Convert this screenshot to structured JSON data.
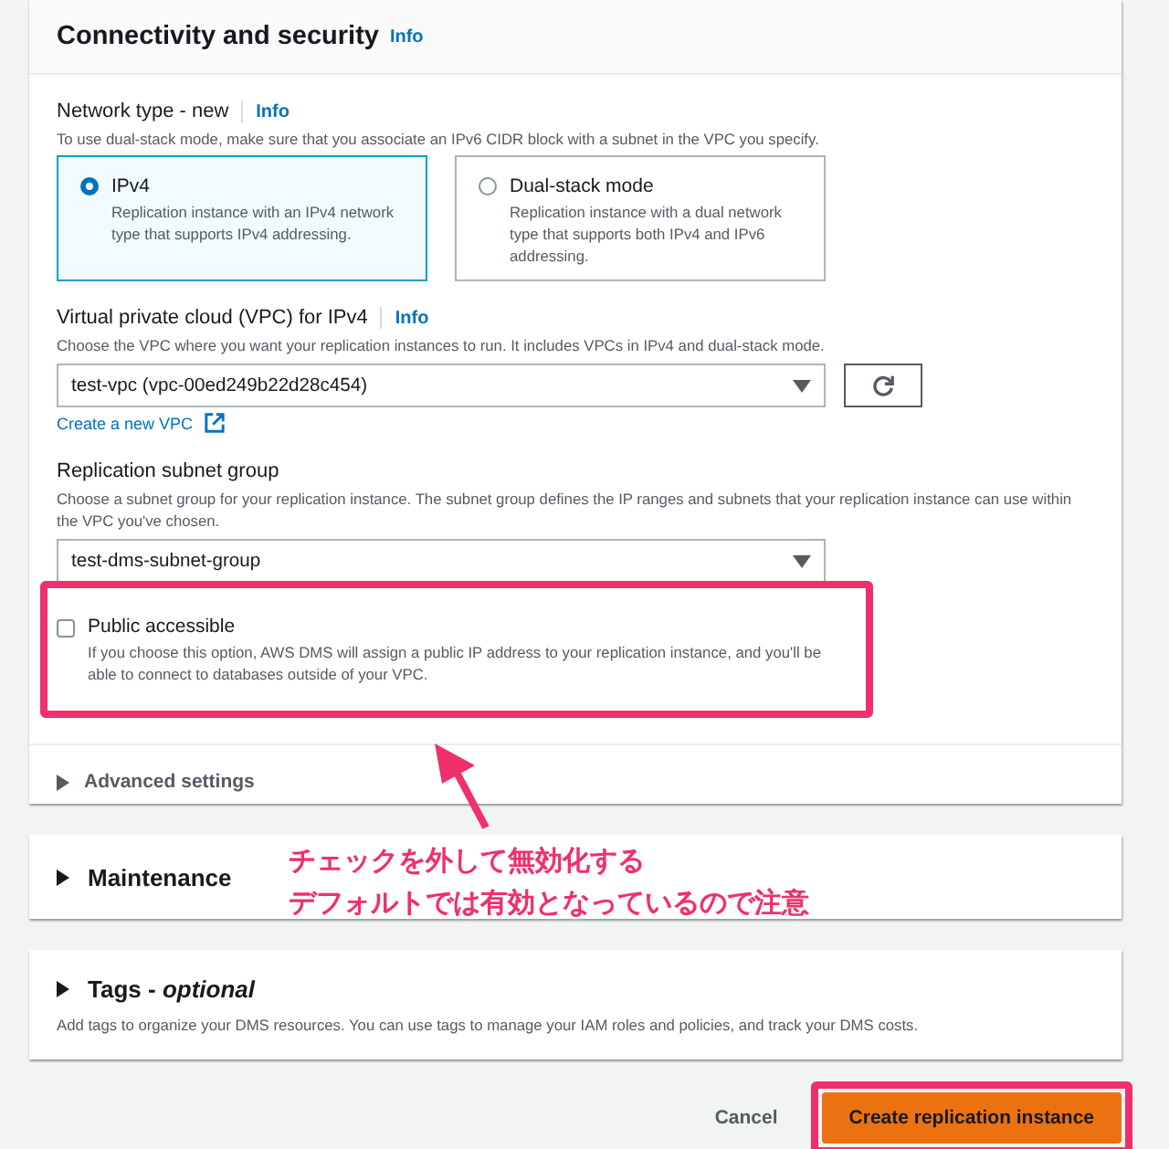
{
  "section": {
    "title": "Connectivity and security",
    "info": "Info"
  },
  "network_type": {
    "label": "Network type - new",
    "info": "Info",
    "description": "To use dual-stack mode, make sure that you associate an IPv6 CIDR block with a subnet in the VPC you specify.",
    "options": [
      {
        "label": "IPv4",
        "description": "Replication instance with an IPv4 network type that supports IPv4 addressing.",
        "selected": true
      },
      {
        "label": "Dual-stack mode",
        "description": "Replication instance with a dual network type that supports both IPv4 and IPv6 addressing.",
        "selected": false
      }
    ]
  },
  "vpc": {
    "label": "Virtual private cloud (VPC) for IPv4",
    "info": "Info",
    "description": "Choose the VPC where you want your replication instances to run. It includes VPCs in IPv4 and dual-stack mode.",
    "value": "test-vpc (vpc-00ed249b22d28c454)",
    "create_link": "Create a new VPC"
  },
  "subnet_group": {
    "label": "Replication subnet group",
    "description": "Choose a subnet group for your replication instance. The subnet group defines the IP ranges and subnets that your replication instance can use within the VPC you've chosen.",
    "value": "test-dms-subnet-group"
  },
  "public_accessible": {
    "label": "Public accessible",
    "description": "If you choose this option, AWS DMS will assign a public IP address to your replication instance, and you'll be able to connect to databases outside of your VPC.",
    "checked": false
  },
  "advanced_settings": {
    "label": "Advanced settings",
    "expanded": false
  },
  "maintenance": {
    "label": "Maintenance",
    "expanded": false
  },
  "tags": {
    "label": "Tags - *optional*",
    "description": "Add tags to organize your DMS resources. You can use tags to manage your IAM roles and policies, and track your DMS costs.",
    "expanded": false
  },
  "annotation": {
    "lines": [
      "チェックを外して無効化する",
      "デフォルトでは有効となっているので注意"
    ]
  },
  "buttons": {
    "cancel": "Cancel",
    "create": "Create replication instance"
  }
}
